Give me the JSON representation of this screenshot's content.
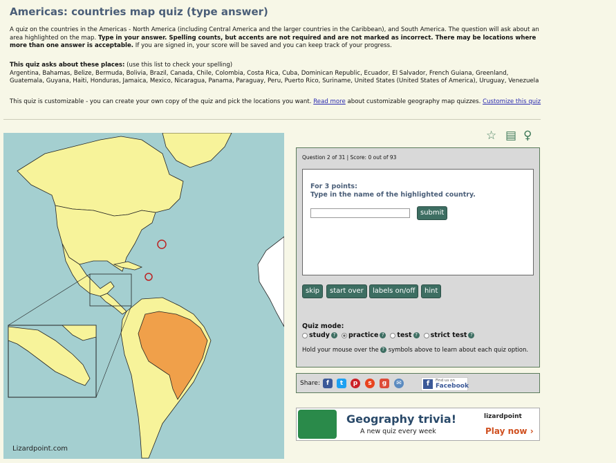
{
  "page": {
    "title": "Americas: countries map quiz (type answer)",
    "intro_1": "A quiz on the countries in the Americas - North America (including Central America and the larger countries in the Caribbean), and South America. The question will ask about an area highlighted on the map. ",
    "intro_bold_1": "Type in your answer. Spelling counts, but accents are not required and are not marked as incorrect. There may be locations where more than one answer is acceptable.",
    "intro_2": " If you are signed in, your score will be saved and you can keep track of your progress.",
    "places_heading": "This quiz asks about these places:",
    "places_note": " (use this list to check your spelling)",
    "places_list": "Argentina, Bahamas, Belize, Bermuda, Bolivia, Brazil, Canada, Chile, Colombia, Costa Rica, Cuba, Dominican Republic, Ecuador, El Salvador, French Guiana, Greenland, Guatemala, Guyana, Haiti, Honduras, Jamaica, Mexico, Nicaragua, Panama, Paraguay, Peru, Puerto Rico, Suriname, United States (United States of America), Uruguay, Venezuela",
    "custom_1": "This quiz is customizable - you can create your own copy of the quiz and pick the locations you want. ",
    "read_more": "Read more",
    "custom_2": " about customizable geography map quizzes. ",
    "customize_link": "Customize this quiz"
  },
  "map": {
    "credit": "Lizardpoint.com",
    "land_color": "#f7f39a",
    "sea_color": "#a4cfd0",
    "highlight_color": "#f0a04a"
  },
  "toolbar": {
    "icons": [
      "star-icon",
      "document-icon",
      "lightbulb-icon"
    ]
  },
  "quiz": {
    "question_info": "Question 2 of 31 | Score: 0 out of 93",
    "points_line": "For 3 points:",
    "instruction": "Type in the name of the highlighted country.",
    "answer_value": "",
    "submit_label": "submit",
    "skip_label": "skip",
    "start_over_label": "start over",
    "labels_label": "labels on/off",
    "hint_label": "hint",
    "mode_heading": "Quiz mode:",
    "modes": [
      "study",
      "practice",
      "test",
      "strict test"
    ],
    "selected_mode": "practice",
    "hold_text": "Hold your mouse over the",
    "hold_text_2": "symbols above to learn about each quiz option."
  },
  "share": {
    "label": "Share:",
    "fb_small": "Find us on",
    "fb_big": "Facebook"
  },
  "trivia": {
    "title": "Geography trivia!",
    "subtitle": "A new quiz every week",
    "brand": "lizardpoint",
    "play": "Play now ›"
  }
}
